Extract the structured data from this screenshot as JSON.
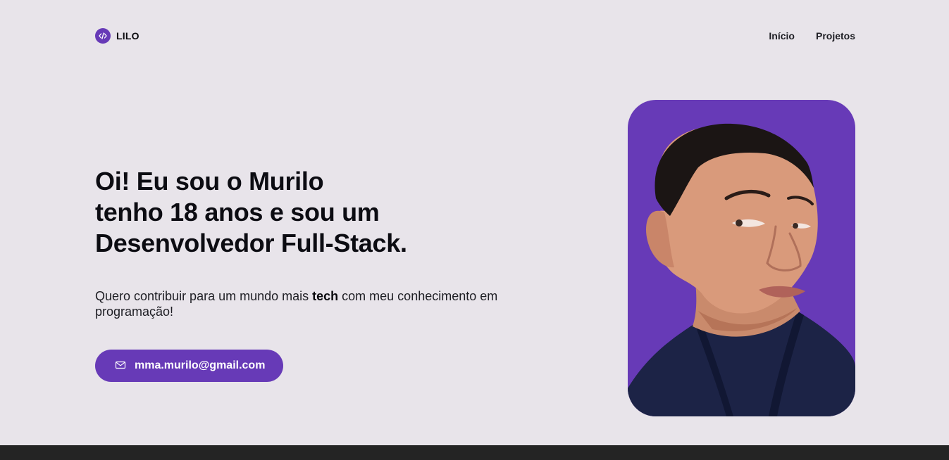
{
  "colors": {
    "background": "#e8e4ea",
    "accent": "#673ab7",
    "footer": "#242424",
    "text": "#0b0b0f"
  },
  "header": {
    "logo_icon": "code-icon",
    "brand": "LILO",
    "nav": [
      {
        "label": "Início"
      },
      {
        "label": "Projetos"
      }
    ]
  },
  "hero": {
    "title_lines": [
      "Oi! Eu sou o Murilo",
      "tenho 18 anos e sou um",
      "Desenvolvedor Full-Stack."
    ],
    "description_before": "Quero contribuir para um mundo mais ",
    "description_bold": "tech",
    "description_after": " com meu conhecimento em programação!",
    "email_icon": "mail-icon",
    "email": "mma.murilo@gmail.com"
  },
  "profile_photo": {
    "icon": "profile-photo"
  }
}
